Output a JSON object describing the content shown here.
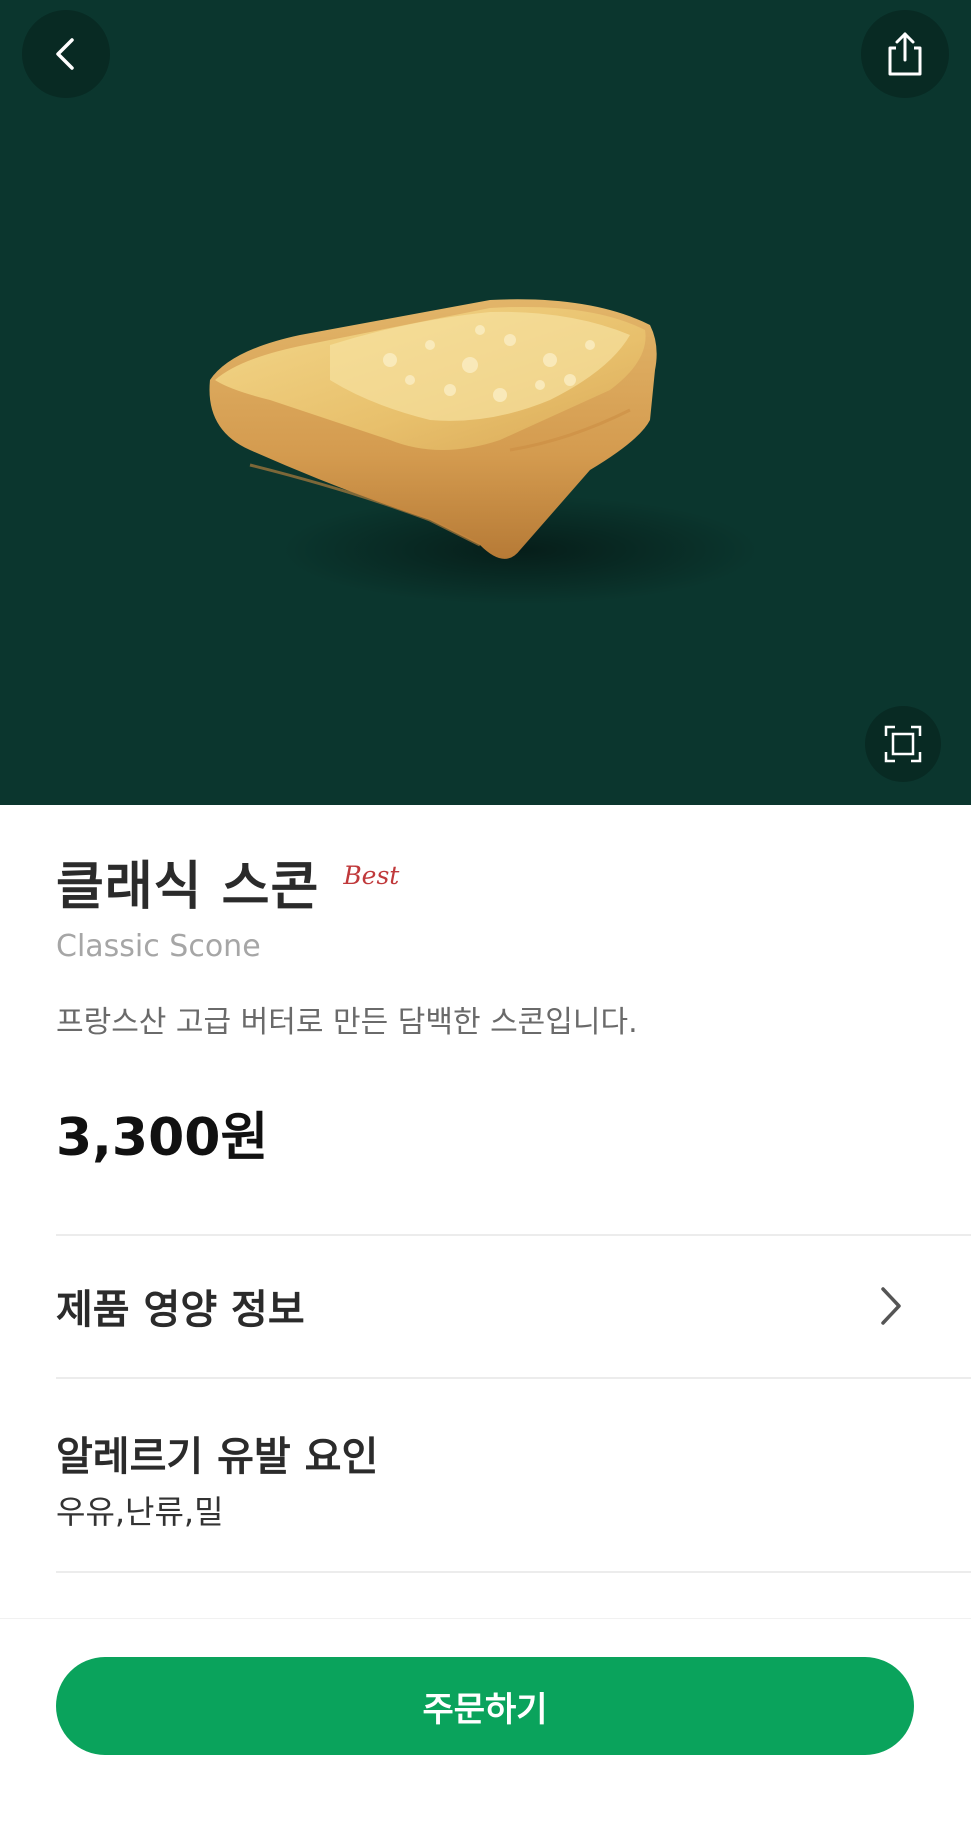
{
  "header": {
    "back_icon": "chevron-left-icon",
    "share_icon": "share-icon",
    "expand_icon": "expand-icon",
    "background_color": "#0b362e"
  },
  "product": {
    "name": "클래식 스콘",
    "badge": "Best",
    "english_name": "Classic Scone",
    "description": "프랑스산 고급 버터로 만든 담백한 스콘입니다.",
    "price": "3,300원"
  },
  "nutrition": {
    "label": "제품 영양 정보",
    "icon": "chevron-right-icon"
  },
  "allergy": {
    "label": "알레르기 유발 요인",
    "value": "우유,난류,밀"
  },
  "order": {
    "label": "주문하기",
    "color": "#0aa35c"
  }
}
